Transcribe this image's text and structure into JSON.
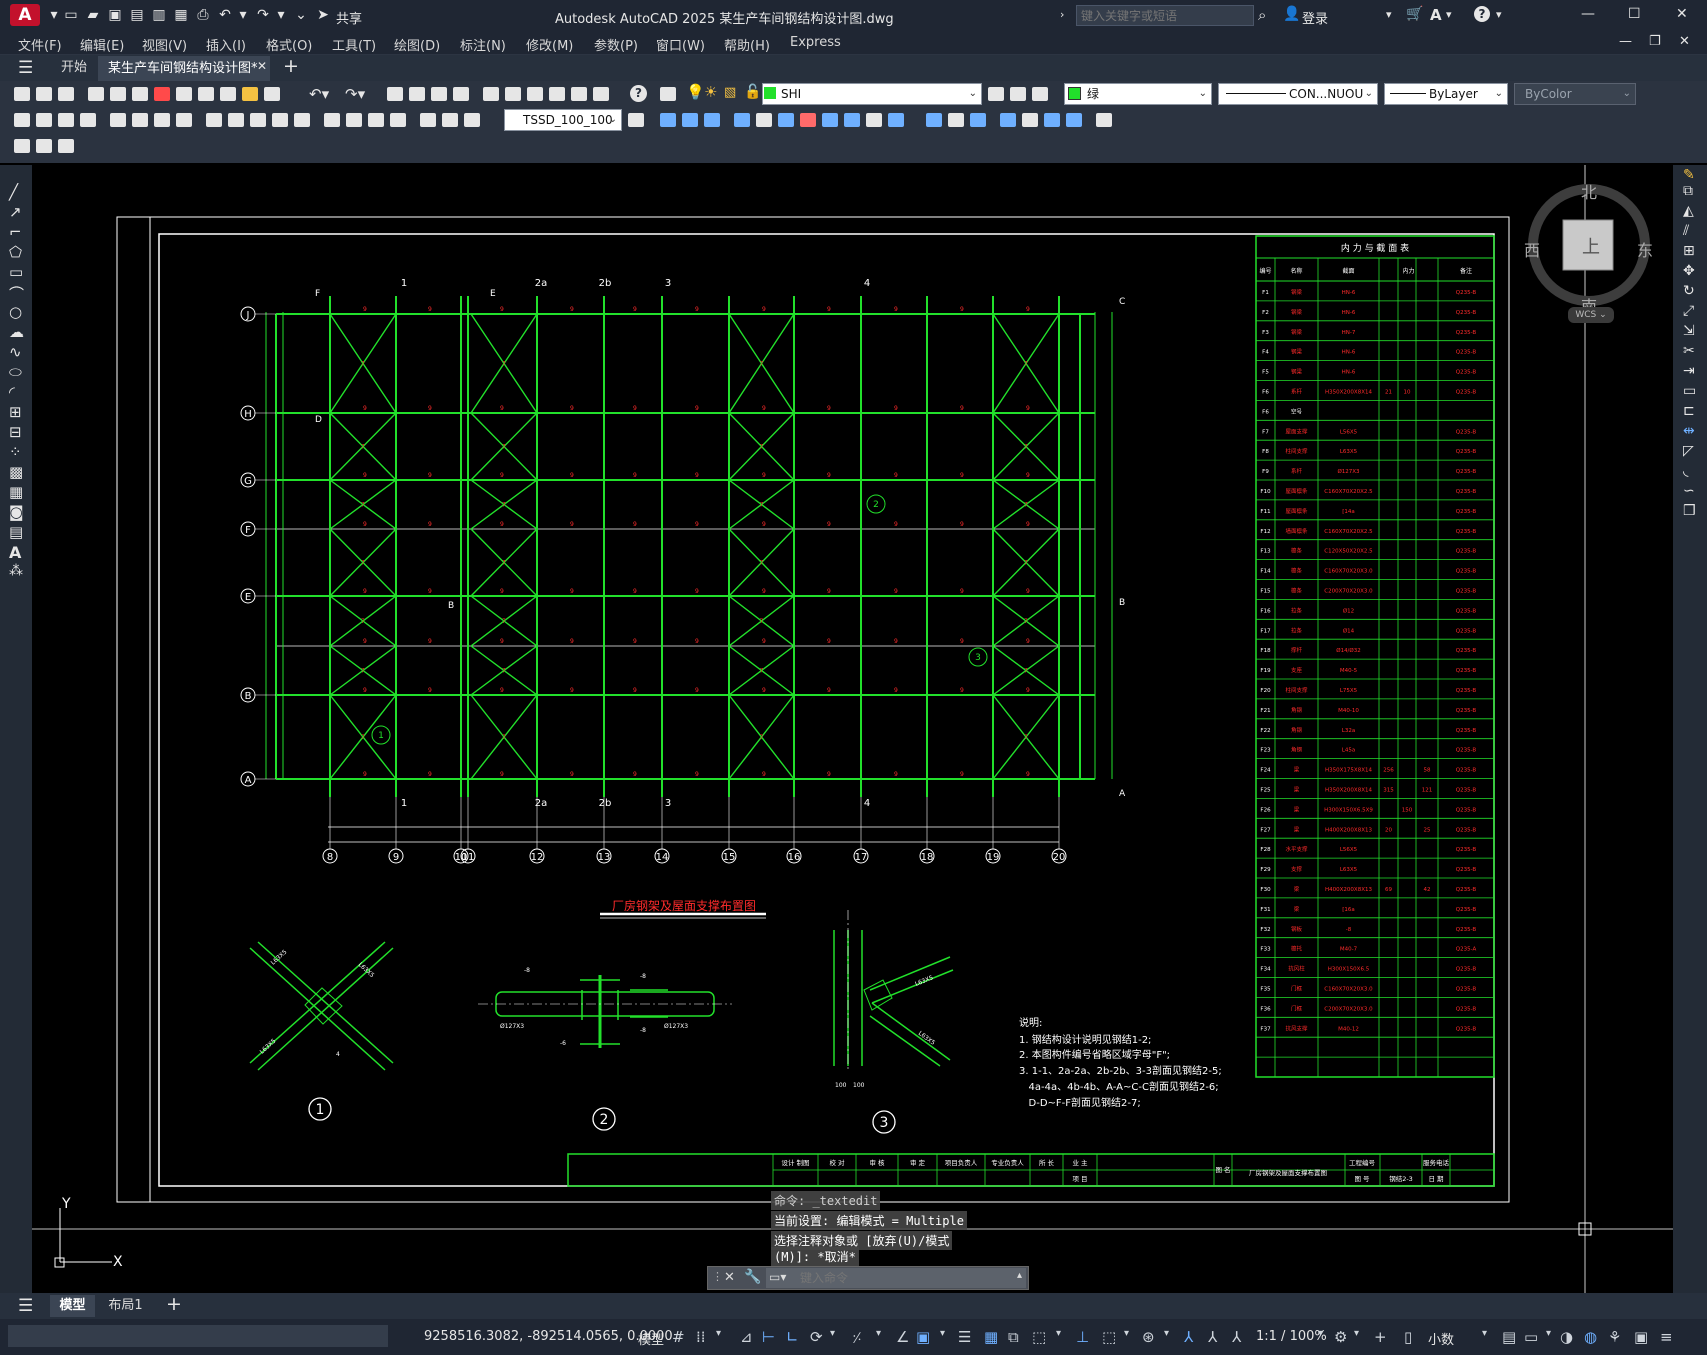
{
  "app": {
    "logo_letter": "A",
    "title": "Autodesk AutoCAD 2025    某生产车间钢结构设计图.dwg",
    "share_label": "共享",
    "search_placeholder": "键入关键字或短语",
    "login_label": "登录"
  },
  "menu": [
    "文件(F)",
    "编辑(E)",
    "视图(V)",
    "插入(I)",
    "格式(O)",
    "工具(T)",
    "绘图(D)",
    "标注(N)",
    "修改(M)",
    "参数(P)",
    "窗口(W)",
    "帮助(H)",
    "Express"
  ],
  "tabs": {
    "start": "开始",
    "document": "某生产车间钢结构设计图*"
  },
  "toolbar": {
    "layer": "SHI",
    "color": "绿",
    "linetype": "CON...NUOU",
    "lineweight": "ByLayer",
    "plotstyle": "ByColor",
    "dimstyle": "TSSD_100_100"
  },
  "viewcube": {
    "north": "北",
    "south": "南",
    "east": "东",
    "west": "西",
    "top": "上",
    "wcs": "WCS"
  },
  "drawing": {
    "plan_title": "厂房钢架及屋面支撑布置图",
    "row_labels": [
      "J",
      "H",
      "G",
      "F",
      "E",
      "B",
      "A"
    ],
    "column_labels": [
      "8",
      "9",
      "10",
      "11",
      "12",
      "13",
      "14",
      "15",
      "16",
      "17",
      "18",
      "19",
      "20"
    ],
    "top_axis_labels": [
      "1",
      "2a",
      "2b",
      "3",
      "4"
    ],
    "section_labels_left": [
      "F",
      "D",
      "B",
      "E"
    ],
    "section_labels_right": [
      "C",
      "B",
      "A"
    ],
    "detail_numbers": [
      "1",
      "2",
      "3"
    ],
    "notes_title": "说明:",
    "notes": [
      "1. 钢结构设计说明见钢结1-2;",
      "2. 本图构件编号省略区域字母\"F\";",
      "3. 1-1、2a-2a、2b-2b、3-3剖面见钢结2-5;",
      "   4a-4a、4b-4b、A-A~C-C剖面见钢结2-6;",
      "   D-D~F-F剖面见钢结2-7;"
    ],
    "table_title": "内 力 与 截 面 表",
    "table_headers": [
      "编号",
      "名称",
      "截面",
      "内力",
      "",
      "",
      "备注"
    ],
    "table_rows": [
      [
        "F1",
        "钢梁",
        "HN-6",
        "",
        "",
        "",
        "Q235-B"
      ],
      [
        "F2",
        "钢梁",
        "HN-6",
        "",
        "",
        "",
        "Q235-B"
      ],
      [
        "F3",
        "钢梁",
        "HN-7",
        "",
        "",
        "",
        "Q235-B"
      ],
      [
        "F4",
        "钢梁",
        "HN-6",
        "",
        "",
        "",
        "Q235-B"
      ],
      [
        "F5",
        "钢梁",
        "HN-6",
        "",
        "",
        "",
        "Q235-B"
      ],
      [
        "F6",
        "系杆",
        "H350X200X8X14",
        "21",
        "10",
        "",
        "Q235-B"
      ],
      [
        "F6",
        "空号",
        "",
        "",
        "",
        "",
        ""
      ],
      [
        "F7",
        "屋面支撑",
        "L56X5",
        "",
        "",
        "",
        "Q235-B"
      ],
      [
        "F8",
        "柱间支撑",
        "L63X5",
        "",
        "",
        "",
        "Q235-B"
      ],
      [
        "F9",
        "系杆",
        "Ø127X3",
        "",
        "",
        "",
        "Q235-B"
      ],
      [
        "F10",
        "屋面檩条",
        "C160X70X20X2.5",
        "",
        "",
        "",
        "Q235-B"
      ],
      [
        "F11",
        "屋面檩条",
        "[14a",
        "",
        "",
        "",
        "Q235-B"
      ],
      [
        "F12",
        "墙面檩条",
        "C160X70X20X2.5",
        "",
        "",
        "",
        "Q235-B"
      ],
      [
        "F13",
        "檩条",
        "C120X50X20X2.5",
        "",
        "",
        "",
        "Q235-B"
      ],
      [
        "F14",
        "檩条",
        "C160X70X20X3.0",
        "",
        "",
        "",
        "Q235-B"
      ],
      [
        "F15",
        "檩条",
        "C200X70X20X3.0",
        "",
        "",
        "",
        "Q235-B"
      ],
      [
        "F16",
        "拉条",
        "Ø12",
        "",
        "",
        "",
        "Q235-B"
      ],
      [
        "F17",
        "拉条",
        "Ø14",
        "",
        "",
        "",
        "Q235-B"
      ],
      [
        "F18",
        "撑杆",
        "Ø14/Ø32",
        "",
        "",
        "",
        "Q235-B"
      ],
      [
        "F19",
        "支座",
        "M40-5",
        "",
        "",
        "",
        "Q235-B"
      ],
      [
        "F20",
        "柱间支撑",
        "L75X5",
        "",
        "",
        "",
        "Q235-B"
      ],
      [
        "F21",
        "角钢",
        "M40-10",
        "",
        "",
        "",
        "Q235-B"
      ],
      [
        "F22",
        "角钢",
        "L32a",
        "",
        "",
        "",
        "Q235-B"
      ],
      [
        "F23",
        "角钢",
        "L45a",
        "",
        "",
        "",
        "Q235-B"
      ],
      [
        "F24",
        "梁",
        "H350X175X8X14",
        "256",
        "",
        "58",
        "Q235-B"
      ],
      [
        "F25",
        "梁",
        "H350X200X8X14",
        "315",
        "",
        "121",
        "Q235-B"
      ],
      [
        "F26",
        "梁",
        "H300X150X6.5X9",
        "",
        "150",
        "",
        "Q235-B"
      ],
      [
        "F27",
        "梁",
        "H400X200X8X13",
        "20",
        "",
        "25",
        "Q235-B"
      ],
      [
        "F28",
        "水平支撑",
        "L56X5",
        "",
        "",
        "",
        "Q235-B"
      ],
      [
        "F29",
        "支撑",
        "L63X5",
        "",
        "",
        "",
        "Q235-B"
      ],
      [
        "F30",
        "梁",
        "H400X200X8X13",
        "69",
        "",
        "42",
        "Q235-B"
      ],
      [
        "F31",
        "梁",
        "[16a",
        "",
        "",
        "",
        "Q235-B"
      ],
      [
        "F32",
        "钢板",
        "-8",
        "",
        "",
        "",
        "Q235-B"
      ],
      [
        "F33",
        "檩托",
        "M40-7",
        "",
        "",
        "",
        "Q235-A"
      ],
      [
        "F34",
        "抗风柱",
        "H300X150X6.5",
        "",
        "",
        "",
        "Q235-B"
      ],
      [
        "F35",
        "门框",
        "C160X70X20X3.0",
        "",
        "",
        "",
        "Q235-B"
      ],
      [
        "F36",
        "门框",
        "C200X70X20X3.0",
        "",
        "",
        "",
        "Q235-B"
      ],
      [
        "F37",
        "抗风支撑",
        "M40-12",
        "",
        "",
        "",
        "Q235-B"
      ]
    ],
    "titleblock": {
      "roles": [
        "设计 制图",
        "校 对",
        "审 核",
        "审 定",
        "项目负责人",
        "专业负责人",
        "所 长",
        "业 主"
      ],
      "project_label": "项 目",
      "drawing_name_label": "图 名",
      "drawing_name": "厂房钢架及屋面支撑布置图",
      "project_no_label": "工程编号",
      "stage_label": "图 号",
      "sheet_no": "钢结2-3",
      "service_label": "服务电话",
      "date_label": "日 期"
    }
  },
  "command": {
    "line1": "命令: _textedit",
    "line2": "当前设置: 编辑模式 = Multiple",
    "line3": "选择注释对象或 [放弃(U)/模式",
    "line4": "(M)]: *取消*",
    "input_placeholder": "键入命令"
  },
  "layouts": {
    "model": "模型",
    "layout1": "布局1"
  },
  "status": {
    "coords": "9258516.3082, -892514.0565, 0.0000",
    "model": "模型",
    "scale": "1:1 / 100%",
    "units": "小数"
  },
  "colors": {
    "drawing_green": "#22e02b",
    "drawing_red": "#ff2b2b",
    "ui_dark": "#1f2633",
    "accent": "#1e90ff"
  }
}
